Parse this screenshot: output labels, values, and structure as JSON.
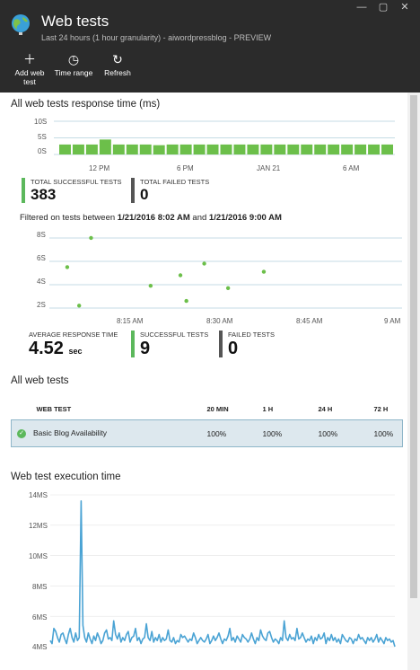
{
  "window": {
    "title": "Web tests",
    "subtitle": "Last 24 hours (1 hour granularity) - aiwordpressblog - PREVIEW"
  },
  "toolbar": {
    "add_label": "Add web test",
    "time_range_label": "Time range",
    "refresh_label": "Refresh"
  },
  "response_chart": {
    "title": "All web tests response time (ms)",
    "y_ticks": [
      "10S",
      "5S",
      "0S"
    ],
    "x_ticks": [
      "12 PM",
      "6 PM",
      "JAN 21",
      "6 AM"
    ]
  },
  "summary": {
    "successful_label": "TOTAL SUCCESSFUL TESTS",
    "successful_value": "383",
    "failed_label": "TOTAL FAILED TESTS",
    "failed_value": "0"
  },
  "filter": {
    "prefix": "Filtered on tests between",
    "start": "1/21/2016 8:02 AM",
    "joiner": "and",
    "end": "1/21/2016 9:00 AM"
  },
  "scatter_chart": {
    "y_ticks": [
      "8S",
      "6S",
      "4S",
      "2S"
    ],
    "x_ticks": [
      "8:15 AM",
      "8:30 AM",
      "8:45 AM",
      "9 AM"
    ]
  },
  "filtered_summary": {
    "avg_label": "AVERAGE RESPONSE TIME",
    "avg_value": "4.52",
    "avg_unit": "sec",
    "successful_label": "SUCCESSFUL TESTS",
    "successful_value": "9",
    "failed_label": "FAILED TESTS",
    "failed_value": "0"
  },
  "web_tests": {
    "title": "All web tests",
    "columns": [
      "WEB TEST",
      "20 MIN",
      "1 H",
      "24 H",
      "72 H"
    ],
    "rows": [
      {
        "name": "Basic Blog Availability",
        "c20": "100%",
        "c1h": "100%",
        "c24h": "100%",
        "c72h": "100%",
        "status": "success"
      }
    ]
  },
  "exec_chart": {
    "title": "Web test execution time",
    "y_ticks": [
      "14MS",
      "12MS",
      "10MS",
      "8MS",
      "6MS",
      "4MS"
    ]
  },
  "colors": {
    "header": "#2b2b2b",
    "success": "#5cb85c",
    "failed": "#555555",
    "line": "#4aa3d4",
    "bar": "#6cbf4a",
    "grid": "#8ab8c9"
  },
  "chart_data": [
    {
      "type": "bar",
      "ylabel": "",
      "ylim": [
        0,
        10
      ],
      "y_unit": "s",
      "categories_count": 24,
      "values": [
        3,
        3,
        3,
        4.5,
        3,
        3,
        3,
        2.8,
        3,
        3,
        3,
        3,
        3,
        3,
        3,
        3,
        3,
        3,
        3,
        3,
        3,
        3,
        3,
        3,
        3
      ],
      "x_tick_labels": [
        "12 PM",
        "6 PM",
        "JAN 21",
        "6 AM"
      ]
    },
    {
      "type": "scatter",
      "ylim": [
        2,
        8
      ],
      "y_unit": "s",
      "x_range": [
        "8:02 AM",
        "9:00 AM"
      ],
      "points": [
        {
          "x": "8:05 AM",
          "y": 5.2
        },
        {
          "x": "8:07 AM",
          "y": 1.9
        },
        {
          "x": "8:09 AM",
          "y": 7.7
        },
        {
          "x": "8:19 AM",
          "y": 3.6
        },
        {
          "x": "8:24 AM",
          "y": 4.5
        },
        {
          "x": "8:25 AM",
          "y": 2.3
        },
        {
          "x": "8:28 AM",
          "y": 5.5
        },
        {
          "x": "8:32 AM",
          "y": 3.4
        },
        {
          "x": "8:38 AM",
          "y": 4.8
        }
      ]
    },
    {
      "type": "line",
      "title": "Web test execution time",
      "ylim": [
        4,
        14
      ],
      "y_unit": "ms",
      "series": [
        {
          "values": [
            4.4,
            4.2,
            5.2,
            5.0,
            4.6,
            4.3,
            4.8,
            4.9,
            4.5,
            4.2,
            4.8,
            5.2,
            4.6,
            4.3,
            4.9,
            4.4,
            4.6,
            13.6,
            5.4,
            4.6,
            4.3,
            4.9,
            4.5,
            4.2,
            4.7,
            4.4,
            4.9,
            4.6,
            4.2,
            4.4,
            4.9,
            5.1,
            4.5,
            4.6,
            4.4,
            5.7,
            4.8,
            4.5,
            4.9,
            4.3,
            4.6,
            4.4,
            4.8,
            5.0,
            4.3,
            4.6,
            4.7,
            5.2,
            4.4,
            4.6,
            4.2,
            4.5,
            4.6,
            5.5,
            4.6,
            4.4,
            5.0,
            4.3,
            4.6,
            4.4,
            4.8,
            4.3,
            4.6,
            4.4,
            4.5,
            5.1,
            4.4,
            4.3,
            4.6,
            4.2,
            4.4,
            4.3,
            4.8,
            4.6,
            4.7,
            4.5,
            4.3,
            4.5,
            4.4,
            4.9,
            4.6,
            4.2,
            4.4,
            4.6,
            4.4,
            4.3,
            4.5,
            4.8,
            4.2,
            4.4,
            4.7,
            4.4,
            4.6,
            4.9,
            4.5,
            4.2,
            4.5,
            4.4,
            4.7,
            5.2,
            4.4,
            4.6,
            4.3,
            4.7,
            4.5,
            4.3,
            4.8,
            4.6,
            4.5,
            4.3,
            4.5,
            4.9,
            4.5,
            4.2,
            4.6,
            4.4,
            5.1,
            4.7,
            4.5,
            4.4,
            4.9,
            5.0,
            4.6,
            4.3,
            4.5,
            4.4,
            4.2,
            4.6,
            4.4,
            5.7,
            4.6,
            4.4,
            4.8,
            4.5,
            4.6,
            4.4,
            5.2,
            4.5,
            4.6,
            4.9,
            4.6,
            4.3,
            4.5,
            4.4,
            4.7,
            4.2,
            4.6,
            4.4,
            4.8,
            4.5,
            4.6,
            4.9,
            4.2,
            4.6,
            4.4,
            4.8,
            4.4,
            4.6,
            4.3,
            4.5,
            4.2,
            4.8,
            4.6,
            4.4,
            4.3,
            4.6,
            4.5,
            4.2,
            4.5,
            4.4,
            4.8,
            4.5,
            4.6,
            4.4,
            4.2,
            4.6,
            4.4,
            4.6,
            4.3,
            4.5,
            4.8,
            4.3,
            4.6,
            4.4,
            4.2,
            4.6,
            4.4,
            4.5,
            4.3,
            4.4,
            4.0
          ]
        }
      ]
    }
  ]
}
